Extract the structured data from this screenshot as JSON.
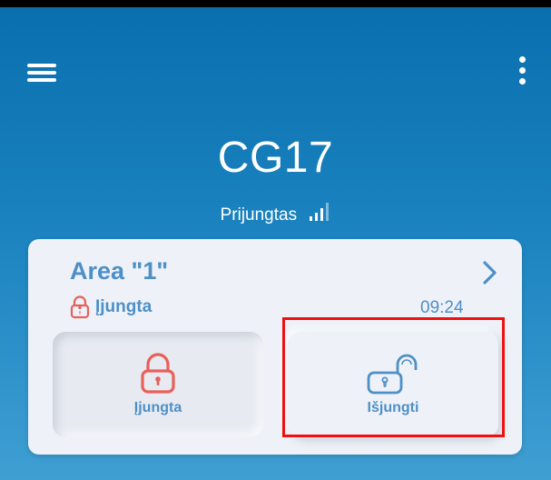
{
  "header": {
    "menu_icon": "hamburger-menu-icon",
    "more_icon": "kebab-menu-icon",
    "device_name": "CG17",
    "connection_status": "Prijungtas",
    "signal_icon": "signal-strength-icon"
  },
  "area_card": {
    "name": "Area \"1\"",
    "state_label": "Įjungta",
    "state_icon": "lock-closed-icon",
    "time": "09:24",
    "chevron_icon": "chevron-right-icon",
    "buttons": [
      {
        "label": "Įjungta",
        "icon": "lock-closed-icon",
        "state": "pressed"
      },
      {
        "label": "Išjungti",
        "icon": "lock-open-icon",
        "state": "raised"
      }
    ]
  },
  "colors": {
    "header_gradient_top": "#0a6fae",
    "header_gradient_bottom": "#3f9fd3",
    "card_bg": "#eef2f8",
    "accent_blue": "#4d8fc7",
    "lock_red": "#e8605a",
    "highlight_red": "#ee1111"
  }
}
